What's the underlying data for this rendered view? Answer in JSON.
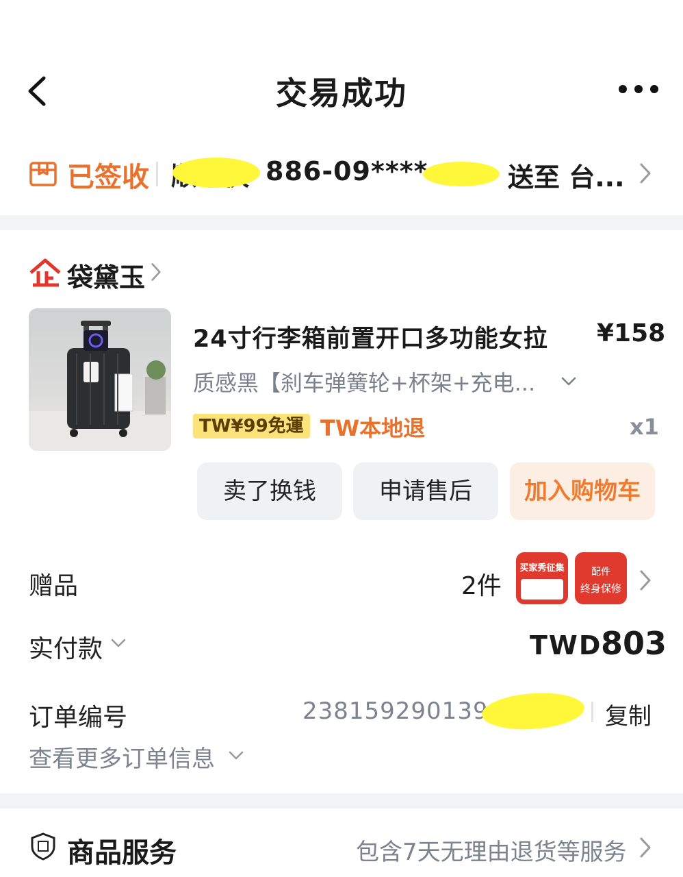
{
  "header": {
    "title": "交易成功"
  },
  "logistics": {
    "status": "已签收",
    "courier": "顺丰快",
    "phone": "886-09****",
    "destination": "送至 台..."
  },
  "shop": {
    "name": "袋黛玉"
  },
  "product": {
    "title": "24寸行李箱前置开口多功能女拉",
    "price": "¥158",
    "variant": "质感黑【刹车弹簧轮+杯架+充电...",
    "badge_shipping": "TW¥99免運",
    "badge_return": "TW本地退",
    "quantity": "x1"
  },
  "actions": {
    "sell": "卖了换钱",
    "aftersale": "申请售后",
    "add_cart": "加入购物车"
  },
  "gift": {
    "label": "赠品",
    "count": "2件",
    "item1_title": "买家秀征集",
    "item2_line1": "配件",
    "item2_line2": "终身保修"
  },
  "payment": {
    "label": "实付款",
    "currency": "TWD",
    "amount": "803"
  },
  "order": {
    "label": "订单编号",
    "number": "238159290139",
    "copy": "复制",
    "more": "查看更多订单信息"
  },
  "service": {
    "title": "商品服务",
    "desc": "包含7天无理由退货等服务"
  },
  "colors": {
    "accent": "#e8712d",
    "badge": "#fbe27b",
    "gift": "#e03a2f"
  }
}
